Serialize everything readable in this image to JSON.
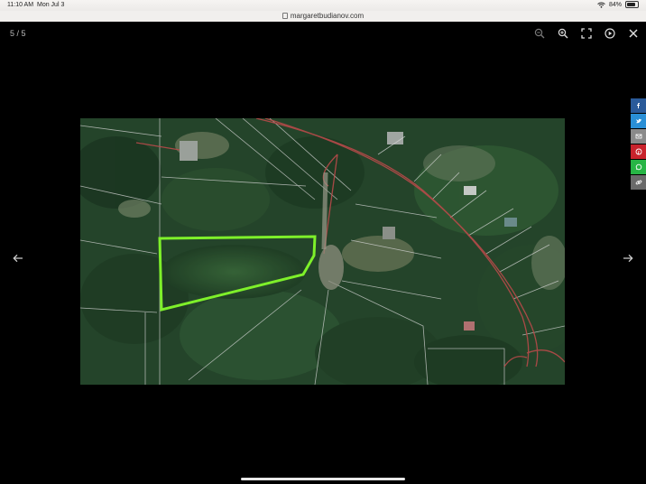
{
  "status": {
    "time": "11:10 AM",
    "date": "Mon Jul 3",
    "battery": "84%"
  },
  "browser": {
    "url": "margaretbudianov.com"
  },
  "viewer": {
    "counter": "5 / 5"
  },
  "toolbar": {
    "icons": [
      "zoom-out-icon",
      "zoom-in-icon",
      "fullscreen-icon",
      "play-icon",
      "close-icon"
    ]
  },
  "share": {
    "items": [
      {
        "name": "facebook",
        "color": "#2a5a9a"
      },
      {
        "name": "twitter",
        "color": "#2a8fd6"
      },
      {
        "name": "email",
        "color": "#8a8a8a"
      },
      {
        "name": "pinterest",
        "color": "#c8232c"
      },
      {
        "name": "whatsapp",
        "color": "#27b545"
      },
      {
        "name": "copy-link",
        "color": "#6a6a6a"
      }
    ]
  },
  "colors": {
    "lot_outline": "#7ef02a",
    "road_lines": "#b84a4a"
  }
}
